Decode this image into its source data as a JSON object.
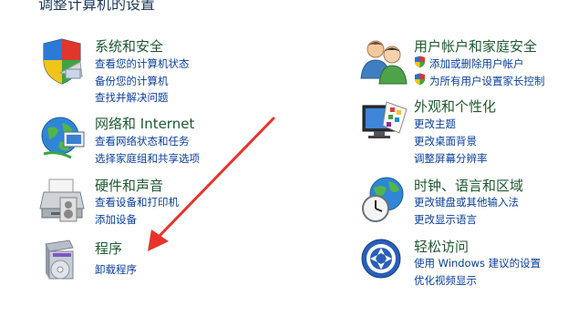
{
  "page": {
    "heading": "调整计算机的设置"
  },
  "left_categories": [
    {
      "title": "系统和安全",
      "icon": "system-security-icon",
      "links": [
        "查看您的计算机状态",
        "备份您的计算机",
        "查找并解决问题"
      ]
    },
    {
      "title": "网络和 Internet",
      "icon": "network-internet-icon",
      "links": [
        "查看网络状态和任务",
        "选择家庭组和共享选项"
      ]
    },
    {
      "title": "硬件和声音",
      "icon": "hardware-sound-icon",
      "links": [
        "查看设备和打印机",
        "添加设备"
      ]
    },
    {
      "title": "程序",
      "icon": "programs-icon",
      "links": [
        "卸载程序"
      ]
    }
  ],
  "right_categories": [
    {
      "title": "用户帐户和家庭安全",
      "icon": "user-accounts-icon",
      "links": [
        "添加或删除用户帐户",
        "为所有用户设置家长控制"
      ]
    },
    {
      "title": "外观和个性化",
      "icon": "appearance-personalization-icon",
      "links": [
        "更改主题",
        "更改桌面背景",
        "调整屏幕分辨率"
      ]
    },
    {
      "title": "时钟、语言和区域",
      "icon": "clock-language-region-icon",
      "links": [
        "更改键盘或其他输入法",
        "更改显示语言"
      ]
    },
    {
      "title": "轻松访问",
      "icon": "ease-of-access-icon",
      "links": [
        "使用 Windows 建议的设置",
        "优化视频显示"
      ]
    }
  ],
  "annotation": {
    "icon": "red-arrow-icon",
    "color": "#e8332b"
  }
}
